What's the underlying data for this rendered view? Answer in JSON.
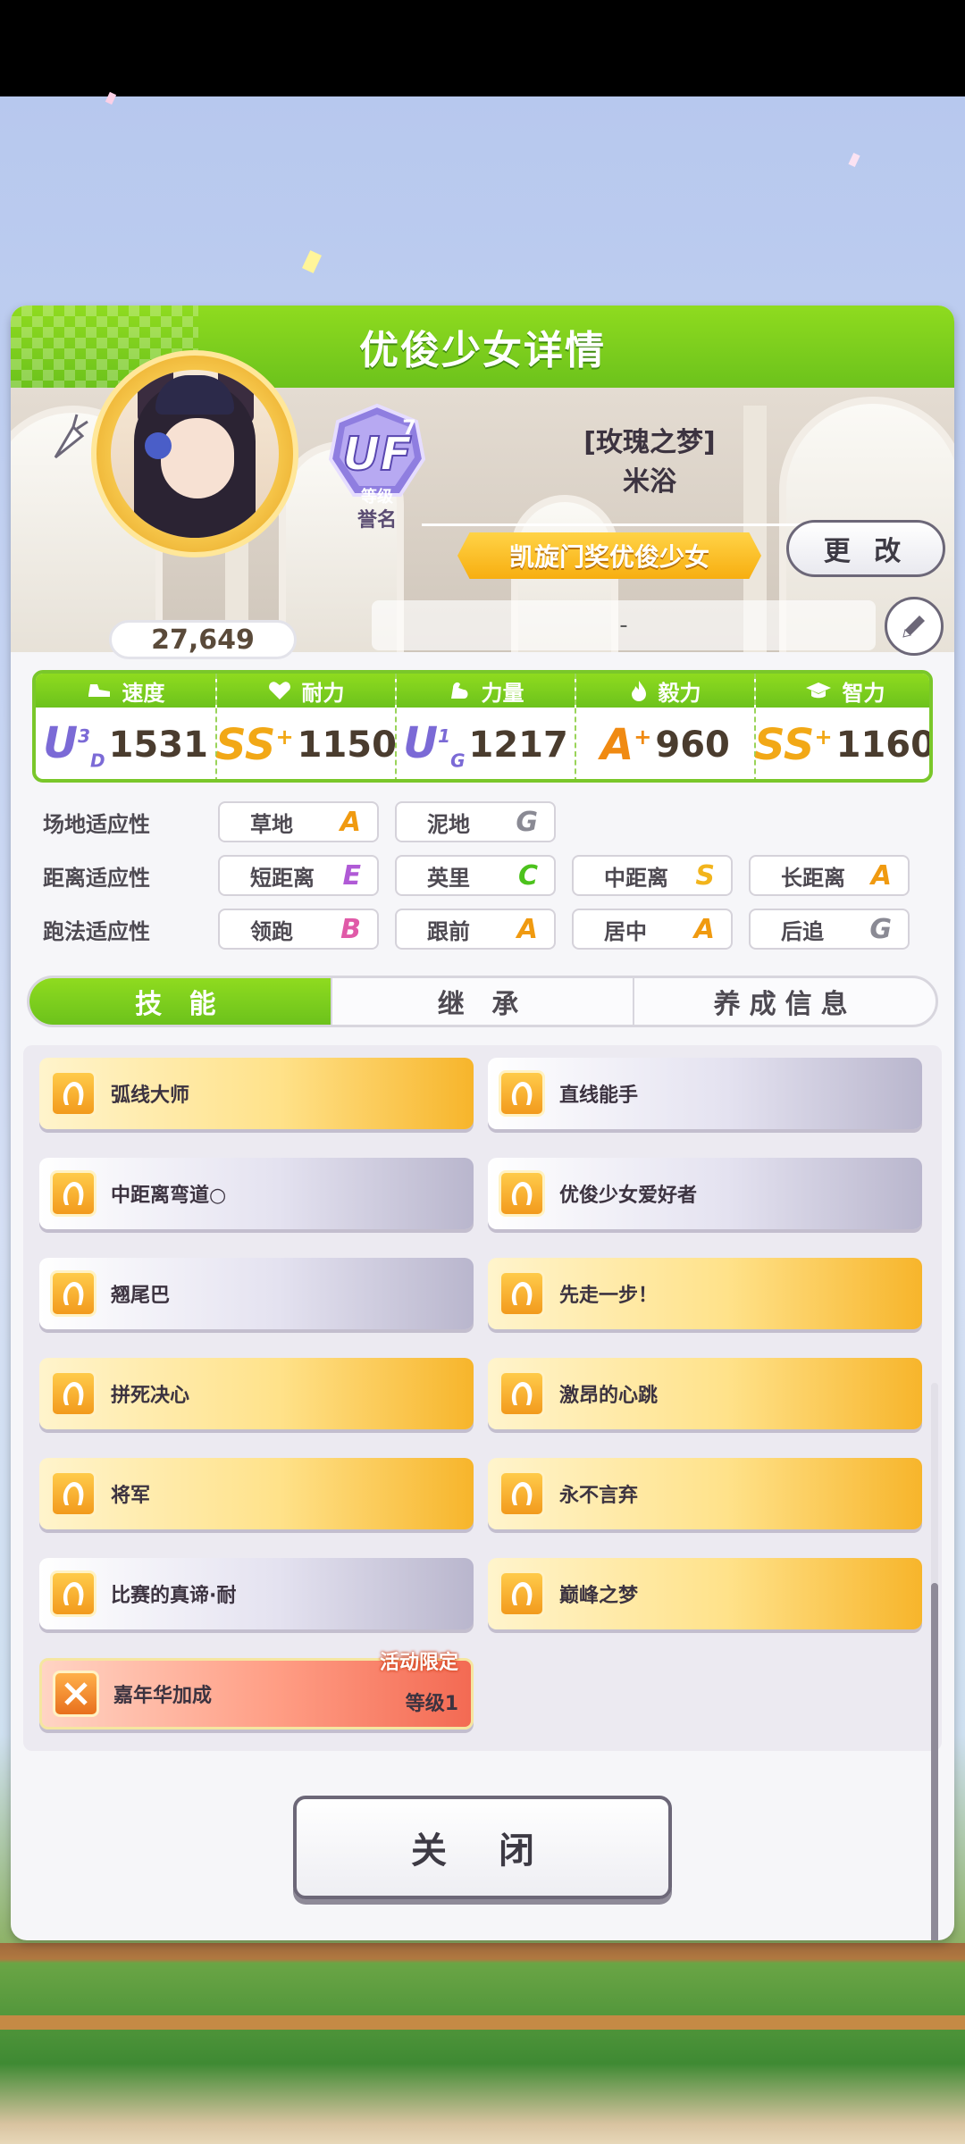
{
  "header": {
    "title": "优俊少女详情"
  },
  "profile": {
    "rating": "27,649",
    "rank": {
      "letters": "UF",
      "superscript": "7",
      "label": "等级",
      "sub_label": "誉名"
    },
    "epithet": "[玫瑰之梦]",
    "name": "米浴",
    "title": "凯旋门奖优俊少女",
    "change_label": "更 改",
    "comment": "-"
  },
  "stats": [
    {
      "label": "速度",
      "grade": "U",
      "grade_sup": "3",
      "grade_sub": "D",
      "value": "1531",
      "icon": "shoe-icon"
    },
    {
      "label": "耐力",
      "grade": "SS",
      "grade_sup": "+",
      "grade_sub": "",
      "value": "1150",
      "icon": "heart-icon"
    },
    {
      "label": "力量",
      "grade": "U",
      "grade_sup": "1",
      "grade_sub": "G",
      "value": "1217",
      "icon": "muscle-icon"
    },
    {
      "label": "毅力",
      "grade": "A",
      "grade_sup": "+",
      "grade_sub": "",
      "value": "960",
      "icon": "flame-icon"
    },
    {
      "label": "智力",
      "grade": "SS",
      "grade_sup": "+",
      "grade_sub": "",
      "value": "1160",
      "icon": "graduation-cap-icon"
    }
  ],
  "aptitudes": {
    "track": {
      "label": "场地适应性",
      "items": [
        {
          "name": "草地",
          "grade": "A"
        },
        {
          "name": "泥地",
          "grade": "G"
        }
      ]
    },
    "distance": {
      "label": "距离适应性",
      "items": [
        {
          "name": "短距离",
          "grade": "E"
        },
        {
          "name": "英里",
          "grade": "C"
        },
        {
          "name": "中距离",
          "grade": "S"
        },
        {
          "name": "长距离",
          "grade": "A"
        }
      ]
    },
    "style": {
      "label": "跑法适应性",
      "items": [
        {
          "name": "领跑",
          "grade": "B"
        },
        {
          "name": "跟前",
          "grade": "A"
        },
        {
          "name": "居中",
          "grade": "A"
        },
        {
          "name": "后追",
          "grade": "G"
        }
      ]
    }
  },
  "grade_colors": {
    "A": "#f09a10",
    "B": "#e05aa8",
    "C": "#4cc21c",
    "E": "#b05ad6",
    "G": "#8a8a94",
    "S": "#f2b41c"
  },
  "stat_grade_colors": {
    "U": "#7b6ad6",
    "SS": "#f2a816",
    "A": "#f08a12"
  },
  "tabs": [
    {
      "label": "技 能",
      "active": true
    },
    {
      "label": "继 承",
      "active": false
    },
    {
      "label": "养成信息",
      "active": false
    }
  ],
  "skills": [
    {
      "name": "弧线大师",
      "rarity": "gold"
    },
    {
      "name": "直线能手",
      "rarity": "normal"
    },
    {
      "name": "中距离弯道○",
      "rarity": "normal"
    },
    {
      "name": "优俊少女爱好者",
      "rarity": "normal"
    },
    {
      "name": "翘尾巴",
      "rarity": "normal"
    },
    {
      "name": "先走一步！",
      "rarity": "gold"
    },
    {
      "name": "拼死决心",
      "rarity": "gold"
    },
    {
      "name": "激昂的心跳",
      "rarity": "gold"
    },
    {
      "name": "将军",
      "rarity": "gold"
    },
    {
      "name": "永不言弃",
      "rarity": "gold"
    },
    {
      "name": "比赛的真谛·耐",
      "rarity": "normal"
    },
    {
      "name": "巅峰之梦",
      "rarity": "gold"
    }
  ],
  "event_skill": {
    "name": "嘉年华加成",
    "tag": "活动限定",
    "level": "等级1"
  },
  "close_label": "关 闭"
}
